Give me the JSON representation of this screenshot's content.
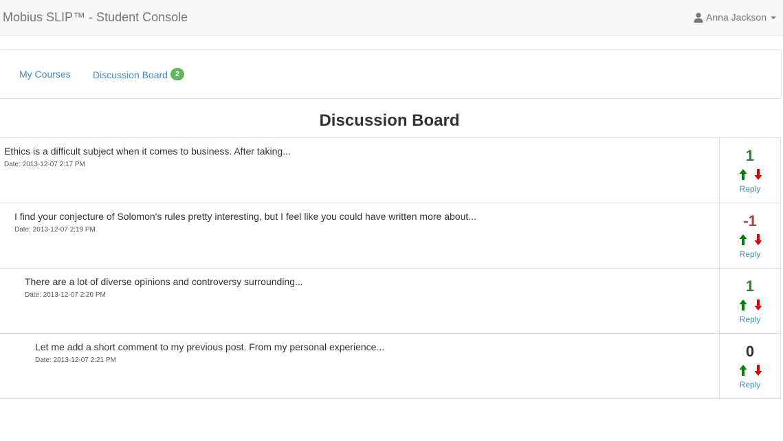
{
  "navbar": {
    "brand": "Mobius SLIP™ - Student Console",
    "user_name": "Anna Jackson"
  },
  "tabs": [
    {
      "label": "My Courses"
    },
    {
      "label": "Discussion Board",
      "badge": "2"
    }
  ],
  "page_title": "Discussion Board",
  "colors": {
    "upvote": "#008000",
    "downvote": "#e00000",
    "positive_score": "#3c763d",
    "negative_score": "#a94442",
    "link": "#428bca",
    "badge": "#5cb85c"
  },
  "posts": [
    {
      "text": "Ethics is a difficult subject when it comes to business. After taking...",
      "date": "Date: 2013-12-07 2:17 PM",
      "score": "1",
      "reply_label": "Reply"
    },
    {
      "text": "I find your conjecture of Solomon's rules pretty interesting, but I feel like you could have written more about...",
      "date": "Date: 2013-12-07 2:19 PM",
      "score": "-1",
      "reply_label": "Reply"
    },
    {
      "text": "There are a lot of diverse opinions and controversy surrounding...",
      "date": "Date: 2013-12-07 2:20 PM",
      "score": "1",
      "reply_label": "Reply"
    },
    {
      "text": "Let me add a short comment to my previous post. From my personal experience...",
      "date": "Date: 2013-12-07 2:21 PM",
      "score": "0",
      "reply_label": "Reply"
    }
  ]
}
